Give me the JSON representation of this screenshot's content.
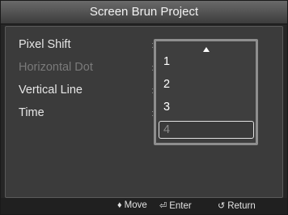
{
  "title": "Screen Brun Project",
  "menu": {
    "items": [
      {
        "label": "Pixel Shift",
        "separator": ":"
      },
      {
        "label": "Horizontal Dot",
        "separator": ":"
      },
      {
        "label": "Vertical Line",
        "separator": ":"
      },
      {
        "label": "Time",
        "separator": ":"
      }
    ]
  },
  "dropdown": {
    "options": [
      "1",
      "2",
      "3",
      "4"
    ],
    "selected": "4"
  },
  "footer": {
    "move": {
      "icon": "updown-arrows-icon",
      "glyph": "♦",
      "label": "Move"
    },
    "enter": {
      "icon": "enter-icon",
      "glyph": "⏎",
      "label": "Enter"
    },
    "return": {
      "icon": "return-icon",
      "glyph": "↺",
      "label": "Return"
    }
  },
  "colors": {
    "background": "#262626",
    "title_bar": "#4f4f4f",
    "text": "#e6e6e6",
    "disabled_text": "#7a7a7a",
    "dropdown_border": "#8e8e8e"
  }
}
